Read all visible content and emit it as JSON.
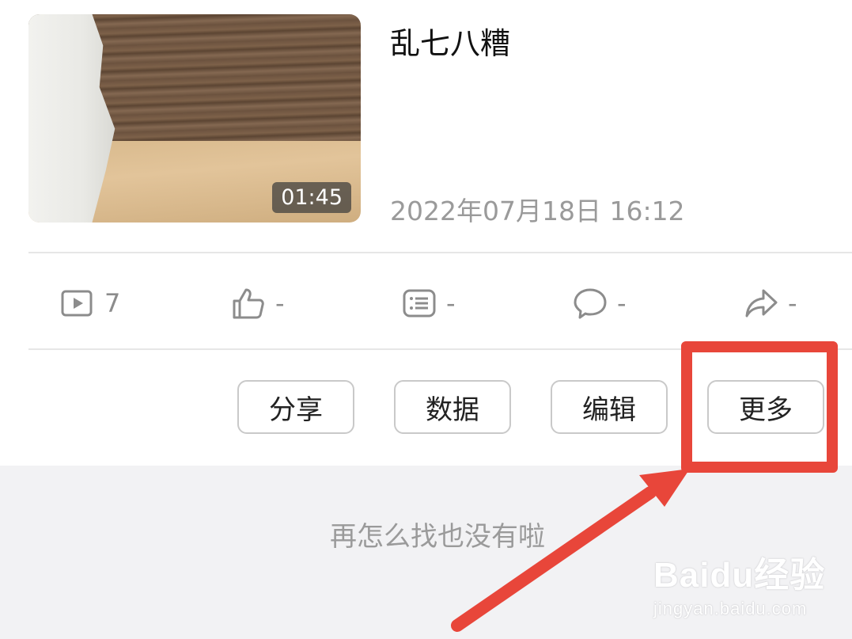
{
  "video": {
    "title": "乱七八糟",
    "date": "2022年07月18日 16:12",
    "duration": "01:45"
  },
  "stats": [
    {
      "icon": "play-icon",
      "value": "7"
    },
    {
      "icon": "thumbs-up-icon",
      "value": "-"
    },
    {
      "icon": "list-icon",
      "value": "-"
    },
    {
      "icon": "comment-icon",
      "value": "-"
    },
    {
      "icon": "share-icon",
      "value": "-"
    }
  ],
  "actions": {
    "share": "分享",
    "data": "数据",
    "edit": "编辑",
    "more": "更多"
  },
  "footer": {
    "end_text": "再怎么找也没有啦"
  },
  "watermark": {
    "brand": "Baidu经验",
    "url": "jingyan.baidu.com"
  },
  "colors": {
    "annotation": "#e8463a",
    "muted_text": "#9a9a9a",
    "footer_bg": "#f2f2f4"
  }
}
